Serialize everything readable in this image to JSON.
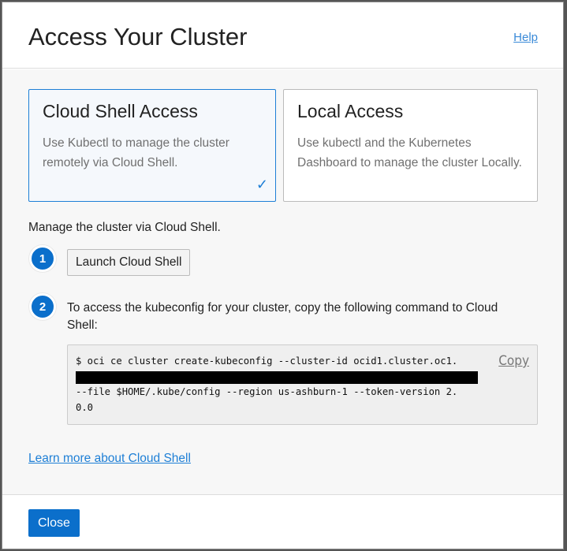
{
  "dialog": {
    "title": "Access Your Cluster",
    "help": "Help"
  },
  "options": [
    {
      "title": "Cloud Shell Access",
      "desc": "Use Kubectl to manage the cluster remotely via Cloud Shell.",
      "selected": true
    },
    {
      "title": "Local Access",
      "desc": "Use kubectl and the Kubernetes Dashboard to manage the cluster Locally.",
      "selected": false
    }
  ],
  "manage_text": "Manage the cluster via Cloud Shell.",
  "steps": [
    {
      "number": "1",
      "button": "Launch Cloud Shell"
    },
    {
      "number": "2",
      "text": "To access the kubeconfig for your cluster, copy the following command to Cloud Shell:"
    }
  ],
  "command": {
    "line1": "$ oci ce cluster create-kubeconfig --cluster-id ocid1.cluster.oc1.",
    "line3": "--file $HOME/.kube/config --region us-ashburn-1 --token-version 2.",
    "line4": "0.0",
    "copy": "Copy"
  },
  "learn_more": "Learn more about Cloud Shell",
  "footer": {
    "close": "Close"
  },
  "colors": {
    "accent": "#0b6fcb",
    "link": "#1e7fd6"
  }
}
